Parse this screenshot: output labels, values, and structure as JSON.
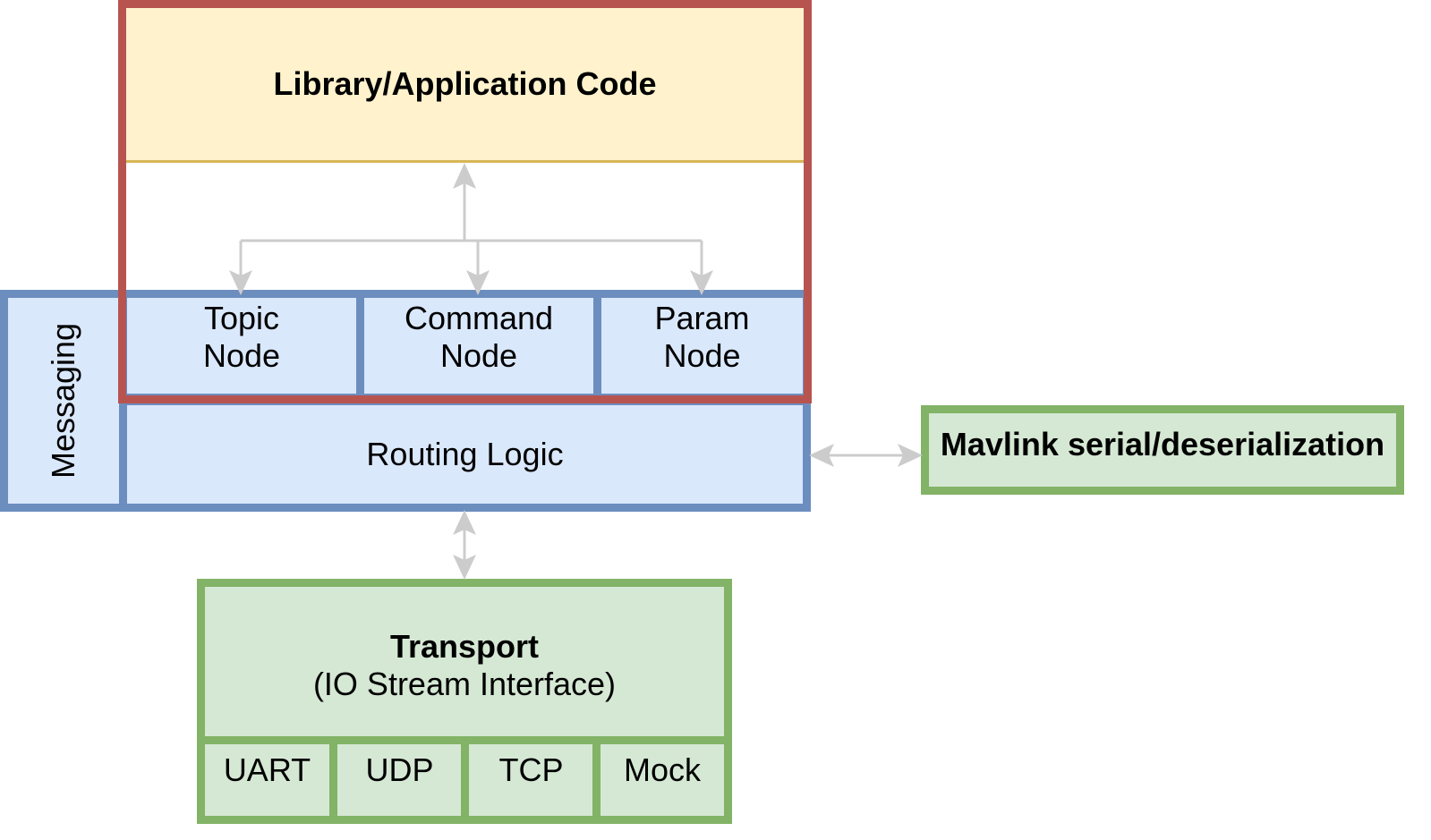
{
  "diagram": {
    "library_app": {
      "label": "Library/Application Code"
    },
    "messaging": {
      "label": "Messaging"
    },
    "nodes": [
      {
        "line1": "Topic",
        "line2": "Node"
      },
      {
        "line1": "Command",
        "line2": "Node"
      },
      {
        "line1": "Param",
        "line2": "Node"
      }
    ],
    "routing": {
      "label": "Routing Logic"
    },
    "mavlink": {
      "label": "Mavlink serial/deserialization"
    },
    "transport": {
      "title": "Transport",
      "subtitle": "(IO Stream Interface)",
      "impls": [
        "UART",
        "UDP",
        "TCP",
        "Mock"
      ]
    },
    "colors": {
      "library_fill": "#fff2cc",
      "library_border": "#d6b656",
      "group_border": "#b85450",
      "blue_fill": "#dae8fc",
      "blue_border": "#6c8ebf",
      "green_fill": "#d5e8d4",
      "green_border": "#82b366",
      "arrow": "#cccccc"
    }
  }
}
